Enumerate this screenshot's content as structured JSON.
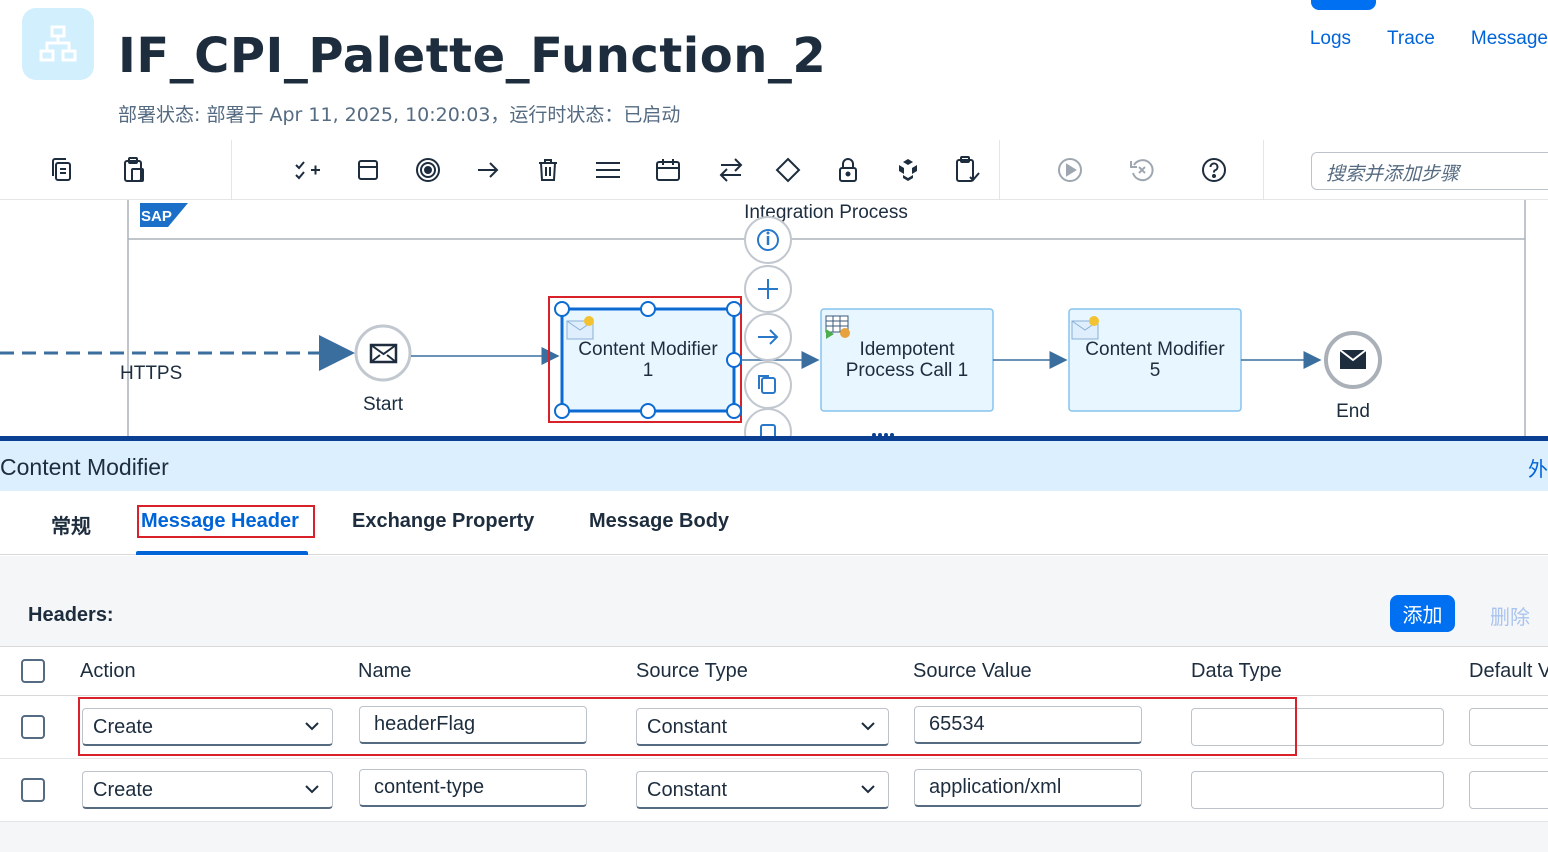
{
  "header": {
    "title": "IF_CPI_Palette_Function_2",
    "subtitle": "部署状态: 部署于 Apr 11, 2025, 10:20:03，运行时状态：已启动",
    "links": [
      "Logs",
      "Trace",
      "Message"
    ]
  },
  "toolbar": {
    "search_placeholder": "搜索并添加步骤"
  },
  "canvas": {
    "pool_label": "Integration Process",
    "sap_logo": "SAP",
    "sender_channel": "HTTPS",
    "start_label": "Start",
    "end_label": "End",
    "steps": [
      {
        "line1": "Content Modifier",
        "line2": "1"
      },
      {
        "line1": "Idempotent",
        "line2": "Process Call 1"
      },
      {
        "line1": "Content Modifier",
        "line2": "5"
      }
    ]
  },
  "panel": {
    "title": "Content Modifier",
    "external_link": "外",
    "tabs": [
      "常规",
      "Message Header",
      "Exchange Property",
      "Message Body"
    ],
    "active_tab": "Message Header",
    "headers_label": "Headers:",
    "add_button": "添加",
    "delete_button": "删除",
    "columns": [
      "Action",
      "Name",
      "Source Type",
      "Source Value",
      "Data Type",
      "Default V"
    ],
    "rows": [
      {
        "action": "Create",
        "name": "headerFlag",
        "source_type": "Constant",
        "source_value": "65534",
        "data_type": "",
        "default": ""
      },
      {
        "action": "Create",
        "name": "content-type",
        "source_type": "Constant",
        "source_value": "application/xml",
        "data_type": "",
        "default": ""
      }
    ]
  },
  "colors": {
    "brand_blue": "#0070f2",
    "link_blue": "#0064d9",
    "highlight_red": "#d9212a",
    "step_fill": "#e8f6ff"
  }
}
